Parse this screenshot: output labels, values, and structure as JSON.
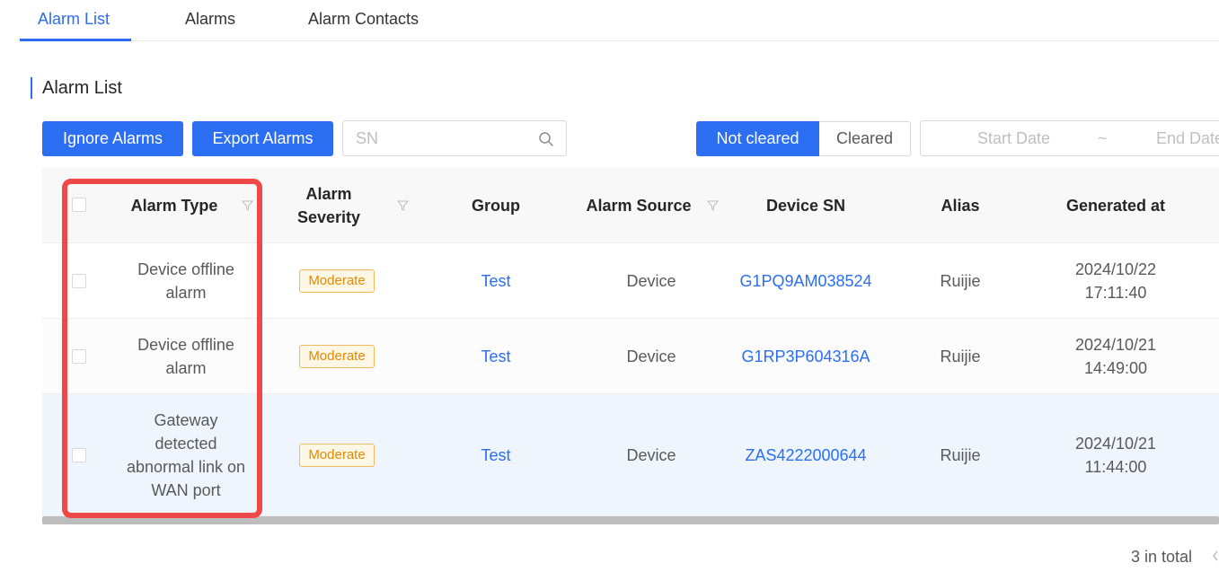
{
  "tabs": [
    {
      "label": "Alarm List",
      "active": true
    },
    {
      "label": "Alarms",
      "active": false
    },
    {
      "label": "Alarm Contacts",
      "active": false
    }
  ],
  "section_title": "Alarm List",
  "toolbar": {
    "ignore_label": "Ignore Alarms",
    "export_label": "Export Alarms",
    "search_placeholder": "SN",
    "search_icon": "search-icon",
    "status_filter": {
      "options": [
        "Not cleared",
        "Cleared"
      ],
      "selected": "Not cleared"
    },
    "date_range": {
      "start_placeholder": "Start Date",
      "separator": "~",
      "end_placeholder": "End Date"
    }
  },
  "table": {
    "columns": [
      "Alarm Type",
      "Alarm Severity",
      "Group",
      "Alarm Source",
      "Device SN",
      "Alias",
      "Generated at"
    ],
    "severity_header_lines": [
      "Alarm",
      "Severity"
    ],
    "rows": [
      {
        "type_lines": [
          "Device offline",
          "alarm"
        ],
        "severity": "Moderate",
        "group": "Test",
        "source": "Device",
        "sn": "G1PQ9AM038524",
        "alias": "Ruijie",
        "generated_lines": [
          "2024/10/22",
          "17:11:40"
        ]
      },
      {
        "type_lines": [
          "Device offline",
          "alarm"
        ],
        "severity": "Moderate",
        "group": "Test",
        "source": "Device",
        "sn": "G1RP3P604316A",
        "alias": "Ruijie",
        "generated_lines": [
          "2024/10/21",
          "14:49:00"
        ]
      },
      {
        "type_lines": [
          "Gateway",
          "detected",
          "abnormal link on",
          "WAN port"
        ],
        "severity": "Moderate",
        "group": "Test",
        "source": "Device",
        "sn": "ZAS4222000644",
        "alias": "Ruijie",
        "generated_lines": [
          "2024/10/21",
          "11:44:00"
        ]
      }
    ]
  },
  "pagination": {
    "total": "3 in total"
  },
  "colors": {
    "primary": "#2b6ef2",
    "highlight": "#f04848",
    "moderate": "#e48a00"
  }
}
